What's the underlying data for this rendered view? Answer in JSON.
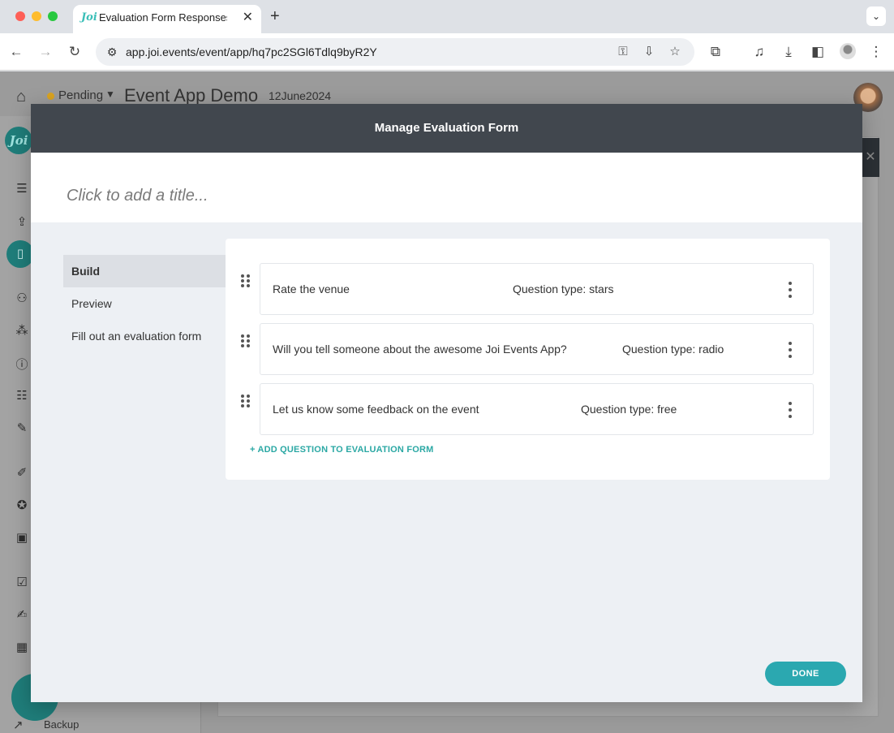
{
  "browser": {
    "tab_title": "Evaluation Form Responses | ",
    "tab_favicon_text": "Joi",
    "url": "app.joi.events/event/app/hq7pc2SGl6Tdlq9byR2Y"
  },
  "app": {
    "status": "Pending",
    "event_name": "Event App Demo",
    "event_date": "12June2024",
    "logo_text": "Joi",
    "backup_label": "Backup"
  },
  "modal": {
    "title": "Manage Evaluation Form",
    "title_placeholder": "Click to add a title...",
    "nav": [
      {
        "label": "Build",
        "active": true
      },
      {
        "label": "Preview",
        "active": false
      },
      {
        "label": "Fill out an evaluation form",
        "active": false
      }
    ],
    "questions": [
      {
        "text": "Rate the venue",
        "type": "Question type: stars"
      },
      {
        "text": "Will you tell someone about the awesome Joi Events App?",
        "type": "Question type: radio"
      },
      {
        "text": "Let us know some feedback on the event",
        "type": "Question type: free"
      }
    ],
    "add_question_label": "+ ADD QUESTION TO EVALUATION FORM",
    "done_label": "DONE"
  },
  "colors": {
    "accent": "#2ba8b0",
    "header": "#41474e",
    "status_pending": "#d9a320"
  }
}
